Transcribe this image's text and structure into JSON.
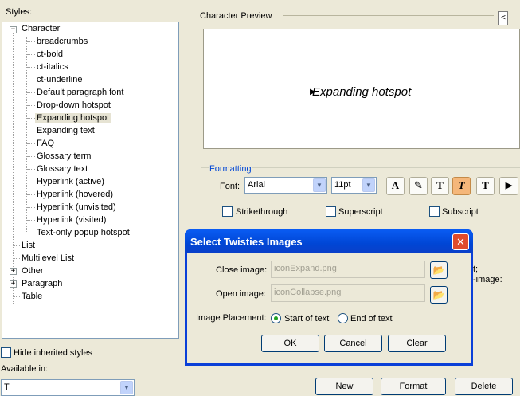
{
  "styles_label": "Styles:",
  "tree": {
    "character": "Character",
    "character_children": [
      "breadcrumbs",
      "ct-bold",
      "ct-italics",
      "ct-underline",
      "Default paragraph font",
      "Drop-down hotspot",
      "Expanding hotspot",
      "Expanding text",
      "FAQ",
      "Glossary term",
      "Glossary text",
      "Hyperlink (active)",
      "Hyperlink (hovered)",
      "Hyperlink (unvisited)",
      "Hyperlink (visited)",
      "Text-only popup hotspot"
    ],
    "selected": "Expanding hotspot",
    "others": [
      "List",
      "Multilevel List",
      "Other",
      "Paragraph",
      "Table"
    ]
  },
  "preview": {
    "label": "Character Preview",
    "text": "Expanding hotspot",
    "arrow_glyph": "▶",
    "nav_left_glyph": "<"
  },
  "formatting": {
    "label": "Formatting",
    "font_label": "Font:",
    "font_value": "Arial",
    "size_value": "11pt",
    "buttons": [
      "A",
      "✎",
      "T",
      "T",
      "T",
      "▶"
    ],
    "strikethrough": "Strikethrough",
    "superscript": "Superscript",
    "subscript": "Subscript"
  },
  "behind_text": [
    "t;",
    "-image:"
  ],
  "bottom": {
    "hide_inherited": "Hide inherited styles",
    "available_in": "Available in:",
    "available_value": "T",
    "buttons": [
      "New",
      "Format",
      "Delete"
    ]
  },
  "dialog": {
    "title": "Select Twisties Images",
    "close_glyph": "✕",
    "close_image_label": "Close image:",
    "close_image_value": "iconExpand.png",
    "open_image_label": "Open image:",
    "open_image_value": "iconCollapse.png",
    "placement_label": "Image Placement:",
    "start_of_text": "Start of text",
    "end_of_text": "End of text",
    "ok": "OK",
    "cancel": "Cancel",
    "clear": "Clear"
  },
  "colors": {
    "dialog_title_bar": "#0046d5",
    "formatting_label": "#0046d5",
    "active_button": "#f5b77a",
    "window_bg": "#ece9d8"
  }
}
